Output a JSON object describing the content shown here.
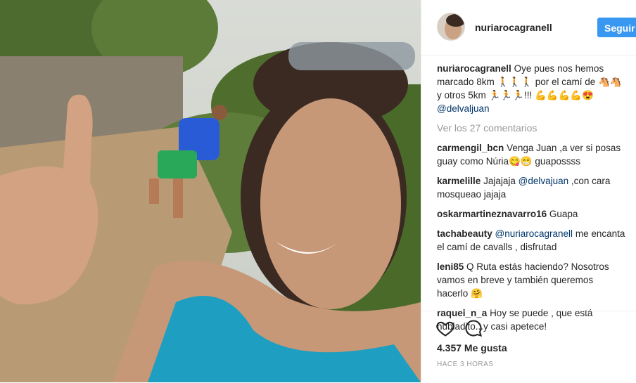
{
  "post": {
    "username": "nuriarocagranell",
    "follow_label": "Seguir",
    "caption_user": "nuriarocagranell",
    "caption_text": "Oye pues nos hemos marcado 8km 🚶🚶🚶 por el camí de 🐴🐴 y otros 5km 🏃🏃🏃!!! 💪💪💪💪😍",
    "caption_mention": "@delvaljuan",
    "view_comments": "Ver los 27 comentarios",
    "likes": "4.357 Me gusta",
    "time": "HACE 3 HORAS"
  },
  "comments": [
    {
      "user": "carmengil_bcn",
      "text": "Venga Juan ,a ver si posas guay como Núria😋😁 guapossss"
    },
    {
      "user": "karmelille",
      "text_before": "Jajajaja",
      "mention": "@delvajuan",
      "text_after": ",con cara mosqueao jajaja"
    },
    {
      "user": "oskarmartineznavarro16",
      "text": "Guapa"
    },
    {
      "user": "tachabeauty",
      "mention": "@nuriarocagranell",
      "text_after": "me encanta el camí de cavalls , disfrutad"
    },
    {
      "user": "leni85",
      "text": "Q Ruta estás haciendo? Nosotros vamos en breve y también queremos hacerlo 🤗"
    },
    {
      "user": "raquel_n_a",
      "text": "Hoy se puede , que está nubladito...y casi apetece!"
    }
  ],
  "icons": {
    "like": "heart-icon",
    "comment": "comment-bubble-icon"
  },
  "colors": {
    "follow_bg": "#3897f0",
    "mention": "#003569",
    "muted": "#999999"
  }
}
